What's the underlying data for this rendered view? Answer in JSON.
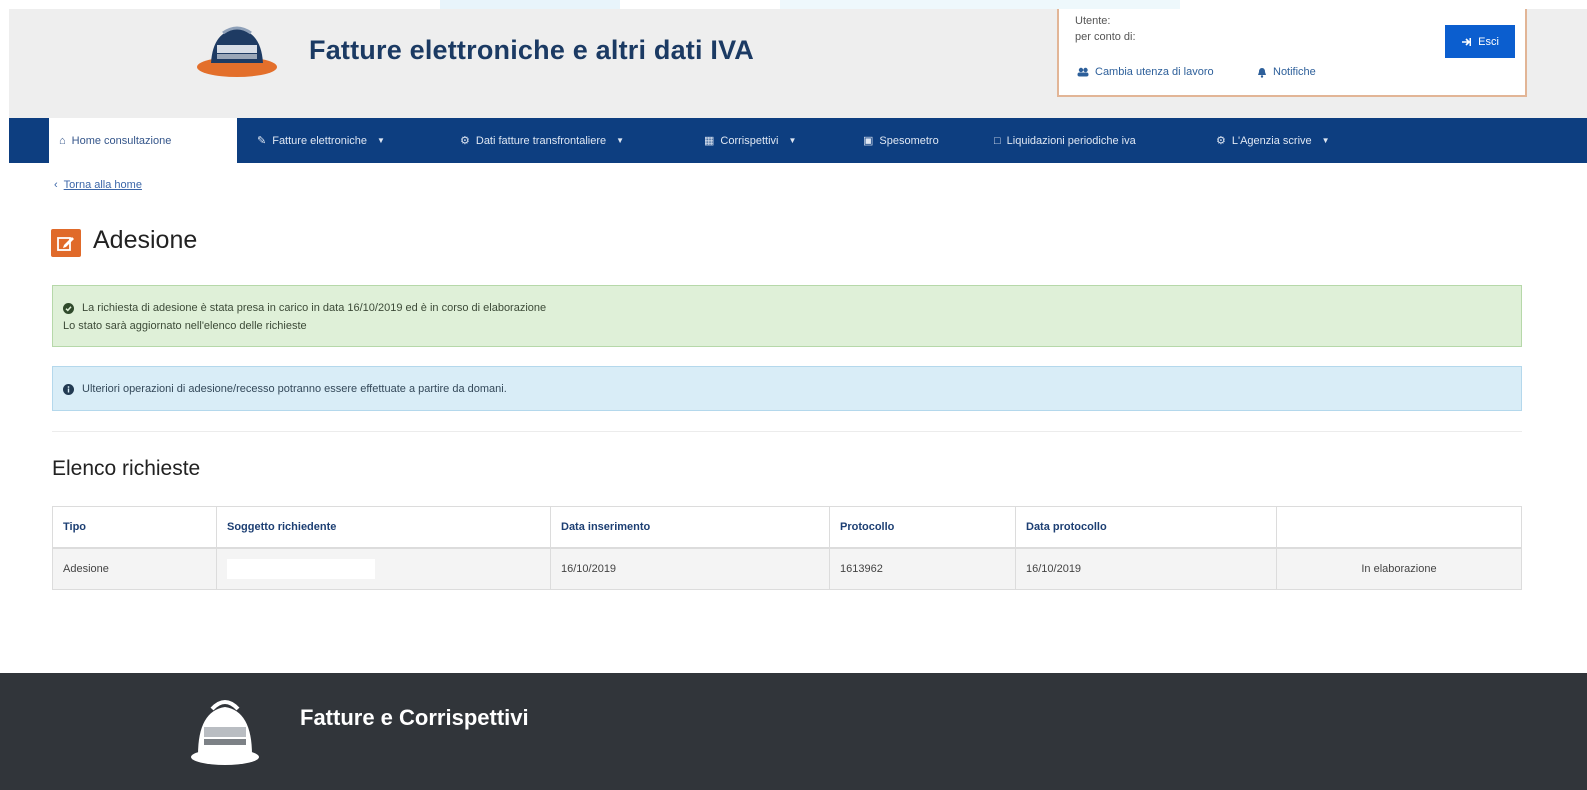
{
  "header": {
    "site_title": "Fatture elettroniche e altri dati IVA",
    "user_label": "Utente:",
    "on_behalf_label": "per conto di:",
    "change_utility_label": "Cambia utenza di lavoro",
    "notifications_label": "Notifiche",
    "logout_label": "Esci"
  },
  "nav": {
    "items": [
      {
        "label": "Home consultazione",
        "icon": "home-icon"
      },
      {
        "label": "Fatture elettroniche",
        "icon": "edit-icon"
      },
      {
        "label": "Dati fatture transfrontaliere",
        "icon": "gear-icon"
      },
      {
        "label": "Corrispettivi",
        "icon": "calculator-icon"
      },
      {
        "label": "Spesometro",
        "icon": "briefcase-icon"
      },
      {
        "label": "Liquidazioni periodiche iva",
        "icon": "file-icon"
      },
      {
        "label": "L'Agenzia scrive",
        "icon": "gear-icon"
      }
    ]
  },
  "breadcrumb": {
    "back_label": "Torna alla home"
  },
  "page": {
    "title": "Adesione"
  },
  "alerts": {
    "success_line1": "La richiesta di adesione è stata presa in carico in data 16/10/2019 ed è in corso di elaborazione",
    "success_line2": "Lo stato sarà aggiornato nell'elenco delle richieste",
    "info_line": "Ulteriori operazioni di adesione/recesso potranno essere effettuate a partire da domani."
  },
  "requests": {
    "section_title": "Elenco richieste",
    "columns": [
      "Tipo",
      "Soggetto richiedente",
      "Data inserimento",
      "Protocollo",
      "Data protocollo",
      ""
    ],
    "rows": [
      {
        "tipo": "Adesione",
        "soggetto": "",
        "data_inserimento": "16/10/2019",
        "protocollo": "1613962",
        "data_protocollo": "16/10/2019",
        "stato": "In elaborazione"
      }
    ]
  },
  "footer": {
    "title": "Fatture e Corrispettivi"
  }
}
